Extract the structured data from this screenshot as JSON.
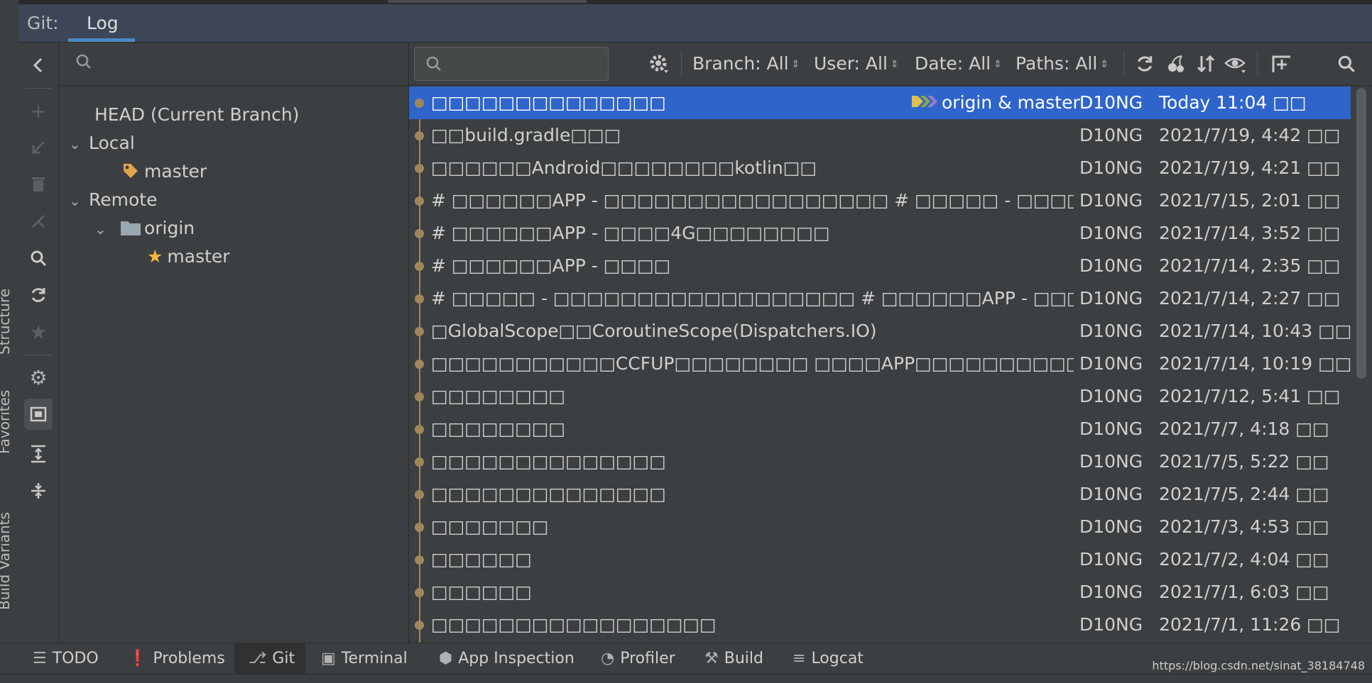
{
  "side_strip": {
    "labels": [
      "Structure",
      "Favorites",
      "Build Variants"
    ]
  },
  "header": {
    "tool_label": "Git:",
    "tab": "Log"
  },
  "branches": {
    "search_placeholder": "",
    "head": "HEAD (Current Branch)",
    "local_label": "Local",
    "local_branch": "master",
    "remote_label": "Remote",
    "remote_name": "origin",
    "remote_branch": "master"
  },
  "log_toolbar": {
    "search_placeholder": "",
    "branch": "Branch: All",
    "user": "User: All",
    "date": "Date: All",
    "paths": "Paths: All"
  },
  "commits": [
    {
      "message": "□□□□□□□□□□□□□□",
      "refs": "origin & master",
      "author": "D10NG",
      "date": "Today 11:04 □□",
      "selected": true
    },
    {
      "message": "□□build.gradle□□□",
      "author": "D10NG",
      "date": "2021/7/19, 4:42 □□"
    },
    {
      "message": "□□□□□□Android□□□□□□□□kotlin□□",
      "author": "D10NG",
      "date": "2021/7/19, 4:21 □□"
    },
    {
      "message": "# □□□□□□APP - □□□□□□□□□□□□□□□□□ # □□□□□ - □□□□□□□□□□□□□ # □",
      "author": "D10NG",
      "date": "2021/7/15, 2:01 □□"
    },
    {
      "message": "# □□□□□□APP - □□□□4G□□□□□□□□",
      "author": "D10NG",
      "date": "2021/7/14, 3:52 □□"
    },
    {
      "message": "# □□□□□□APP - □□□□",
      "author": "D10NG",
      "date": "2021/7/14, 2:35 □□"
    },
    {
      "message": "# □□□□□ - □□□□□□□□□□□□□□□□□□ # □□□□□□APP - □□□□□□□□□□□□",
      "author": "D10NG",
      "date": "2021/7/14, 2:27 □□"
    },
    {
      "message": "□GlobalScope□□CoroutineScope(Dispatchers.IO)",
      "author": "D10NG",
      "date": "2021/7/14, 10:43 □□"
    },
    {
      "message": "□□□□□□□□□□□CCFUP□□□□□□□□ □□□□APP□□□□□□□□□□",
      "author": "D10NG",
      "date": "2021/7/14, 10:19 □□"
    },
    {
      "message": "□□□□□□□□",
      "author": "D10NG",
      "date": "2021/7/12, 5:41 □□"
    },
    {
      "message": "□□□□□□□□",
      "author": "D10NG",
      "date": "2021/7/7, 4:18 □□"
    },
    {
      "message": "□□□□□□□□□□□□□□",
      "author": "D10NG",
      "date": "2021/7/5, 5:22 □□"
    },
    {
      "message": "□□□□□□□□□□□□□□",
      "author": "D10NG",
      "date": "2021/7/5, 2:44 □□"
    },
    {
      "message": "□□□□□□□",
      "author": "D10NG",
      "date": "2021/7/3, 4:53 □□"
    },
    {
      "message": "□□□□□□",
      "author": "D10NG",
      "date": "2021/7/2, 4:04 □□"
    },
    {
      "message": "□□□□□□",
      "author": "D10NG",
      "date": "2021/7/1, 6:03 □□"
    },
    {
      "message": "□□□□□□□□□□□□□□□□□",
      "author": "D10NG",
      "date": "2021/7/1, 11:26 □□"
    }
  ],
  "bottom_tabs": [
    "TODO",
    "Problems",
    "Git",
    "Terminal",
    "App Inspection",
    "Profiler",
    "Build",
    "Logcat"
  ],
  "watermark": "https://blog.csdn.net/sinat_38184748",
  "colors": {
    "selection": "#2f65ca",
    "graph": "#a2865b",
    "tag": "#e0a64b",
    "star": "#f5b63f"
  }
}
